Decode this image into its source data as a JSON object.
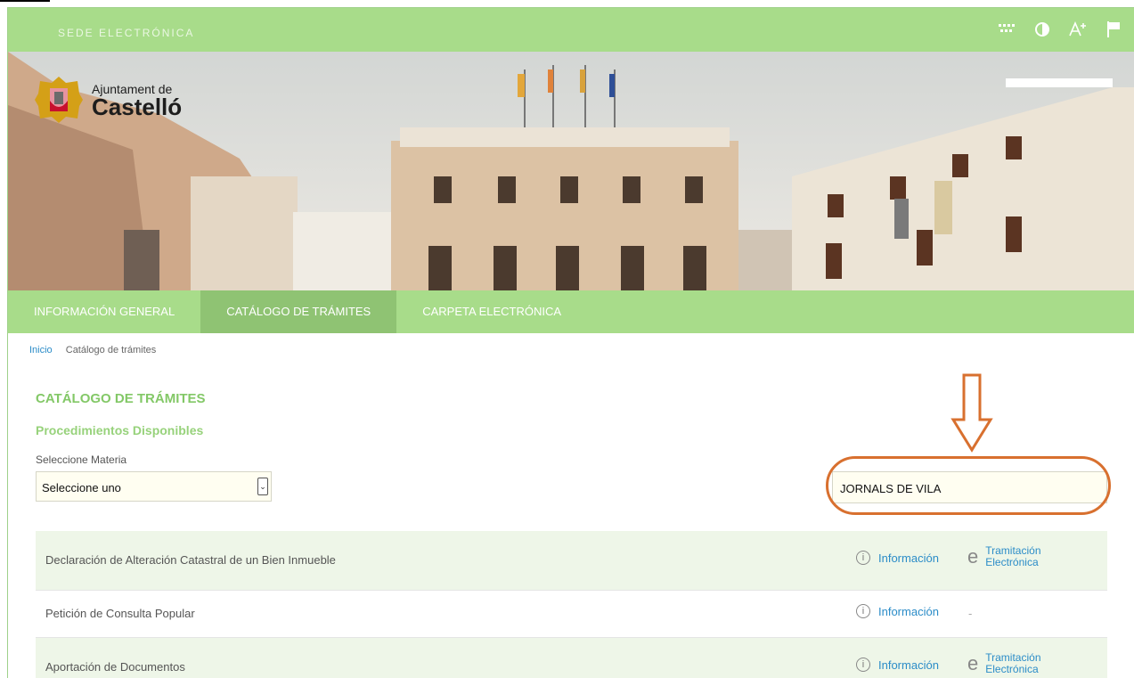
{
  "header": {
    "site_title": "SEDE ELECTRÓNICA",
    "tools": [
      {
        "icon": "keyboard-grid-icon"
      },
      {
        "icon": "contrast-icon"
      },
      {
        "icon": "font-size-icon"
      },
      {
        "icon": "flag-icon"
      }
    ]
  },
  "banner": {
    "logo_line1": "Ajuntament de",
    "logo_line2": "Castelló"
  },
  "nav": {
    "items": [
      {
        "label": "INFORMACIÓN GENERAL",
        "active": false
      },
      {
        "label": "CATÁLOGO DE TRÁMITES",
        "active": true
      },
      {
        "label": "CARPETA ELECTRÓNICA",
        "active": false
      }
    ]
  },
  "breadcrumb": {
    "home": "Inicio",
    "current": "Catálogo de trámites"
  },
  "main": {
    "title": "CATÁLOGO DE TRÁMITES",
    "subtitle": "Procedimientos Disponibles",
    "select_label": "Seleccione Materia",
    "select_value": "Seleccione uno",
    "search_value": "JORNALS DE VILA"
  },
  "procedures": [
    {
      "name": "Declaración de Alteración Catastral de un Bien Inmueble",
      "info": "Información",
      "tramitacion_line1": "Tramitación",
      "tramitacion_line2": "Electrónica"
    },
    {
      "name": "Petición de Consulta Popular",
      "info": "Información",
      "tramitacion_line1": "-",
      "tramitacion_line2": ""
    },
    {
      "name": "Aportación de Documentos",
      "info": "Información",
      "tramitacion_line1": "Tramitación",
      "tramitacion_line2": "Electrónica"
    }
  ],
  "colors": {
    "green": "#a8dc8a",
    "green_active": "#8fc373",
    "link": "#2b8cc8",
    "annotation": "#d8702f"
  }
}
